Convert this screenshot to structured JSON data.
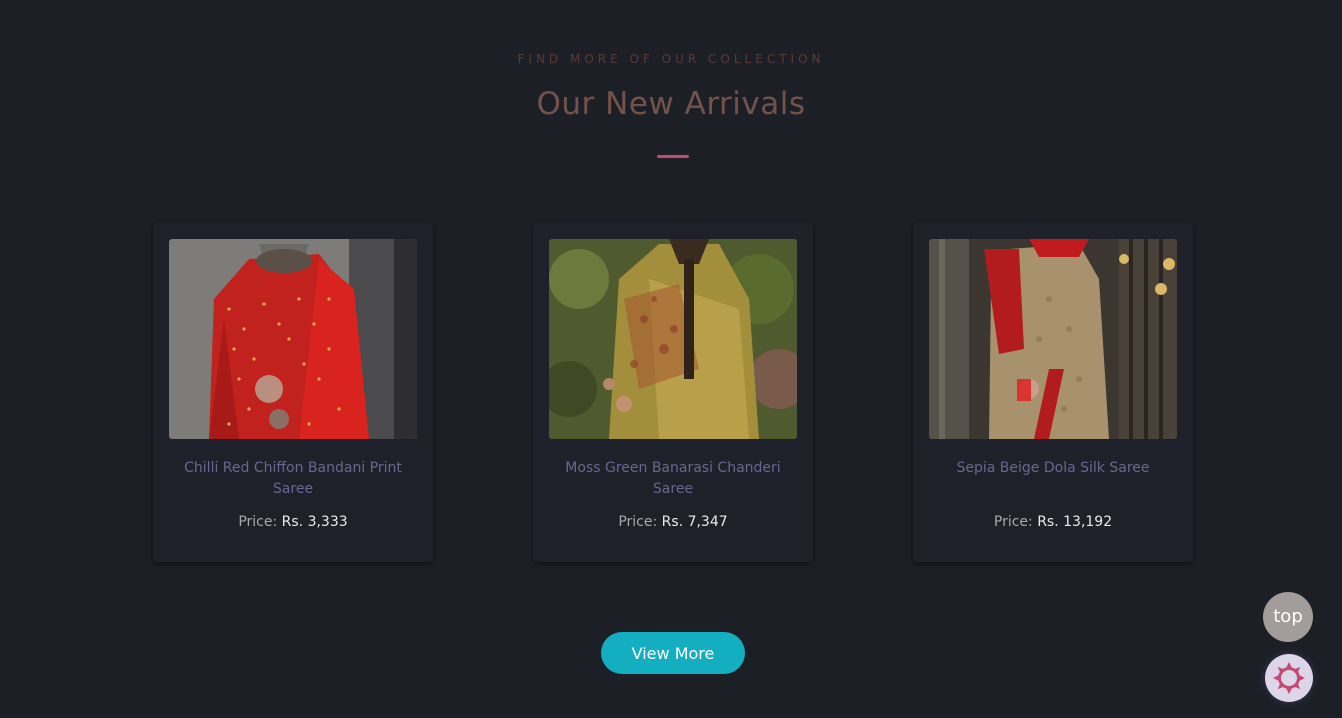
{
  "section": {
    "eyebrow": "FIND MORE OF OUR COLLECTION",
    "title": "Our New Arrivals"
  },
  "products": [
    {
      "name": "Chilli Red Chiffon Bandani Print Saree",
      "price_label": "Price:",
      "price_value": "Rs. 3,333"
    },
    {
      "name": "Moss Green Banarasi Chanderi Saree",
      "price_label": "Price:",
      "price_value": "Rs. 7,347"
    },
    {
      "name": "Sepia Beige Dola Silk Saree",
      "price_label": "Price:",
      "price_value": "Rs. 13,192"
    }
  ],
  "actions": {
    "view_more": "View More",
    "top": "top"
  },
  "icons": {
    "theme_toggle": "sun-gear-icon"
  },
  "colors": {
    "background": "#1c1f26",
    "accent": "#c24b6f",
    "button": "#13aebf",
    "heading": "#73524a"
  }
}
